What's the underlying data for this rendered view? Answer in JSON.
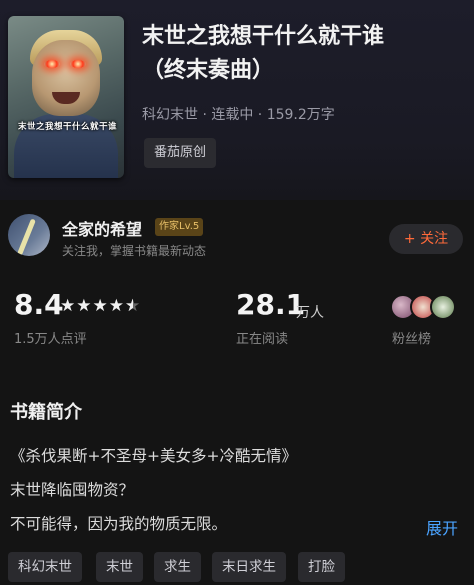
{
  "book": {
    "title_line1": "末世之我想干什么就干谁",
    "title_line2": "（终末奏曲）",
    "meta": "科幻末世 · 连载中 · 159.2万字",
    "source": "番茄原创",
    "cover_text": "末世之我想干什么就干谁"
  },
  "author": {
    "name": "全家的希望",
    "badge": "作家Lv.5",
    "subtitle": "关注我，掌握书籍最新动态",
    "follow_label": "+ 关注"
  },
  "stats": {
    "rating": "8.4",
    "rating_stars": 4.5,
    "rating_count": "1.5万人点评",
    "reading": "28.1",
    "reading_unit": "万人",
    "reading_label": "正在阅读",
    "fans_label": "粉丝榜"
  },
  "intro": {
    "title": "书籍简介",
    "lines": [
      "《杀伐果断+不圣母+美女多+冷酷无情》",
      "末世降临囤物资？",
      "不可能得，因为我的物质无限。"
    ],
    "expand_label": "展开"
  },
  "tags": [
    "科幻末世",
    "末世",
    "求生",
    "末日求生",
    "打脸"
  ],
  "icons": {
    "star": "star-icon",
    "avatar": "author-avatar",
    "fans": "fan-avatar"
  },
  "colors": {
    "background": "#141414",
    "accent_follow": "#ff6a3a",
    "link": "#4aa3ff",
    "badge": "#e8c068"
  }
}
